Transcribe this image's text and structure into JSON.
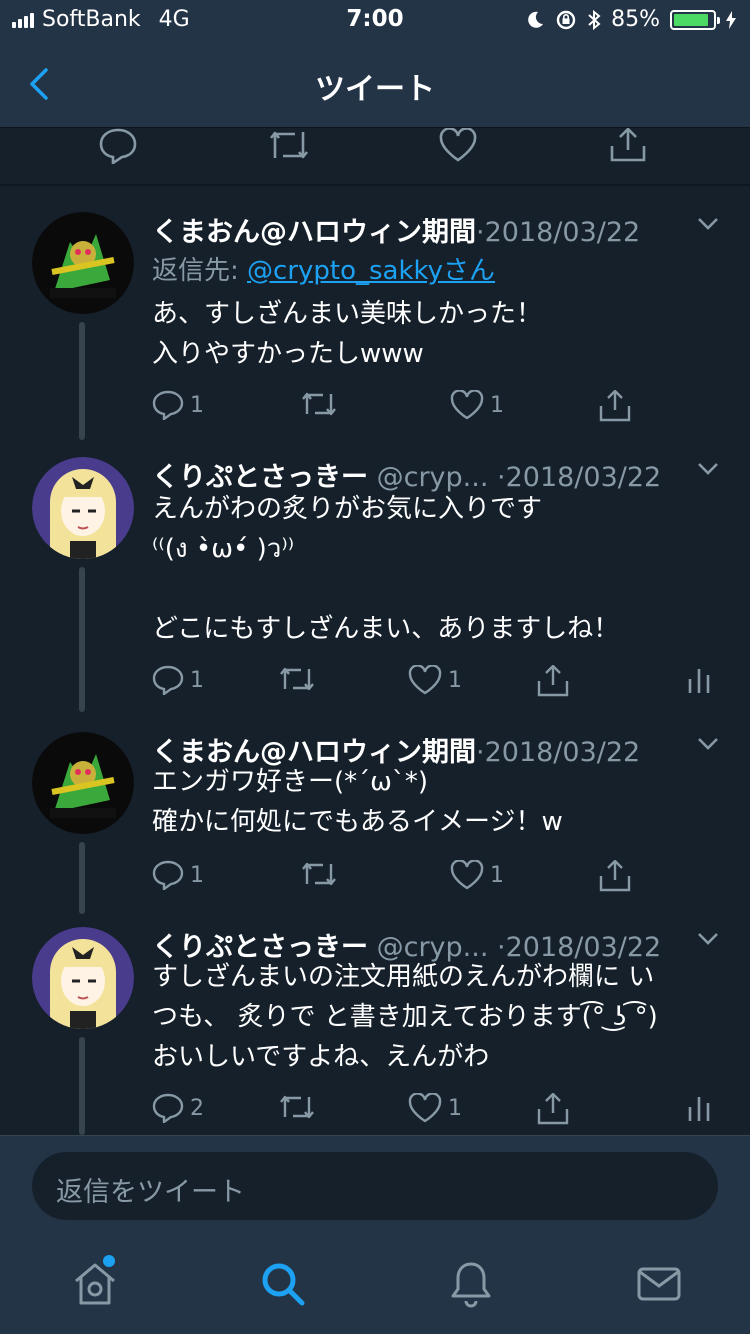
{
  "status_bar": {
    "carrier": "SoftBank",
    "network": "4G",
    "time": "7:00",
    "battery_percent": "85%",
    "battery_level": 0.85
  },
  "nav": {
    "title": "ツイート",
    "back_icon": "chevron-left-icon"
  },
  "tweets": [
    {
      "name": "くまおん@ハロウィン期間",
      "handle": "",
      "separator": "·",
      "date": "2018/03/22",
      "reply_prefix": "返信先: ",
      "reply_to": "@crypto_sakkyさん",
      "text": "あ、すしざんまい美味しかった！\n入りやすかったしwww",
      "replies": "1",
      "retweets": "",
      "likes": "1"
    },
    {
      "name": "くりぷとさっきー",
      "handle": "@cryp...",
      "separator": "·",
      "date": "2018/03/22",
      "text": "えんがわの炙りがお気に入りです\n⁽⁽(ง •̀ω•́ )ว⁾⁾\n\nどこにもすしざんまい、ありますしね！",
      "replies": "1",
      "retweets": "",
      "likes": "1"
    },
    {
      "name": "くまおん@ハロウィン期間",
      "handle": "",
      "separator": "·",
      "date": "2018/03/22",
      "text": "エンガワ好きー(*´ω`*)\n確かに何処にでもあるイメージ！w",
      "replies": "1",
      "retweets": "",
      "likes": "1"
    },
    {
      "name": "くりぷとさっきー",
      "handle": "@cryp...",
      "separator": "·",
      "date": "2018/03/22",
      "text": "すしざんまいの注文用紙のえんがわ欄に い\nつも、 炙りで と書き加えております(͡° ͜ʖ ͡°)\nおいしいですよね、えんがわ",
      "replies": "2",
      "retweets": "",
      "likes": "1"
    }
  ],
  "reply_bar": {
    "placeholder": "返信をツイート"
  },
  "tabs": [
    "home-icon",
    "search-icon",
    "notifications-icon",
    "messages-icon"
  ],
  "colors": {
    "background": "#15202b",
    "bar": "#243447",
    "accent": "#1da1f2",
    "muted": "#8899a6"
  }
}
